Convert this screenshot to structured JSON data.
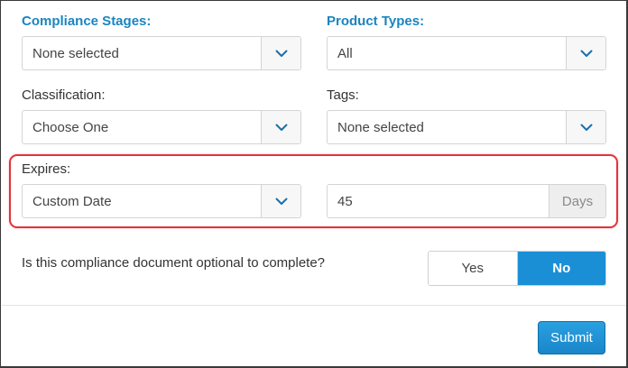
{
  "compliance_stages": {
    "label": "Compliance Stages:",
    "value": "None selected"
  },
  "product_types": {
    "label": "Product Types:",
    "value": "All"
  },
  "classification": {
    "label": "Classification:",
    "value": "Choose One"
  },
  "tags": {
    "label": "Tags:",
    "value": "None selected"
  },
  "expires": {
    "label": "Expires:",
    "value": "Custom Date",
    "days_value": "45",
    "days_addon": "Days"
  },
  "optional_question": {
    "text": "Is this compliance document optional to complete?",
    "yes_label": "Yes",
    "no_label": "No",
    "selected": "No"
  },
  "submit_label": "Submit",
  "colors": {
    "accent": "#1a8fd6",
    "label_accent": "#1a85bf",
    "highlight": "#e0343c"
  },
  "icons": {
    "caret": "chevron-down-icon"
  }
}
